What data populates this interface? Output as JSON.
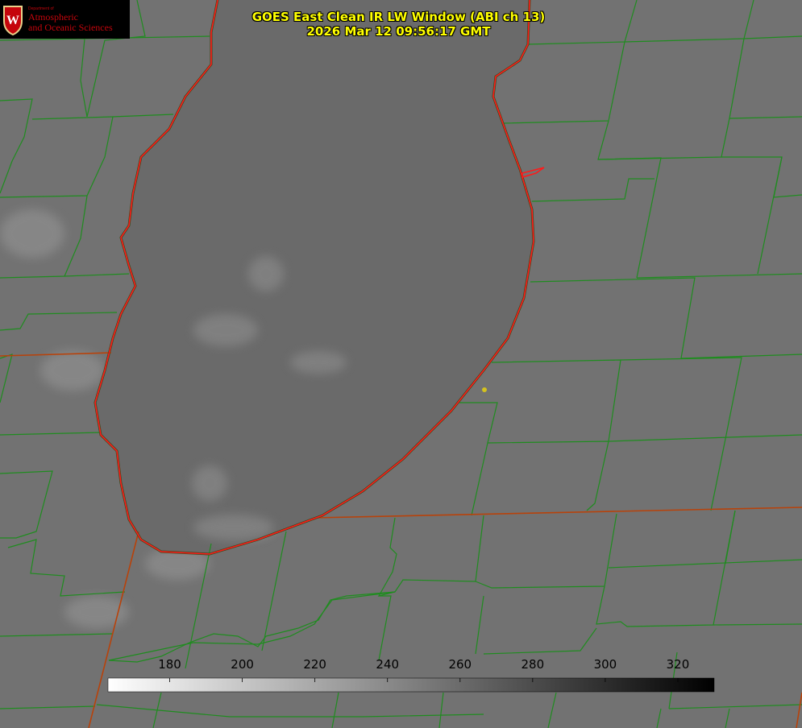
{
  "header": {
    "title_line1": "GOES East Clean IR LW Window (ABI ch 13)",
    "title_line2": "2026 Mar 12 09:56:17 GMT"
  },
  "logo": {
    "dept_small": "Department of",
    "line1": "Atmospheric",
    "line2": "and Oceanic Sciences",
    "crest_letter": "W"
  },
  "colorbar": {
    "min": 163,
    "max": 330,
    "ticks": [
      180,
      200,
      220,
      240,
      260,
      280,
      300,
      320
    ],
    "tick_labels": [
      "180",
      "200",
      "220",
      "240",
      "260",
      "280",
      "300",
      "320"
    ],
    "gradient_from": "#ffffff",
    "gradient_to": "#000000"
  },
  "colors": {
    "background_gray": "#707070",
    "lake_gray": "#6a6a6a",
    "county_lines": "#1f8c1f",
    "state_lines": "#b8420a",
    "coastline": "#ff1a1a",
    "title_text": "#ffff00",
    "logo_red": "#c5050c",
    "marker_dot": "#d4c21e"
  },
  "icons": {
    "logo": "uw-crest-icon",
    "marker": "location-dot-icon"
  }
}
